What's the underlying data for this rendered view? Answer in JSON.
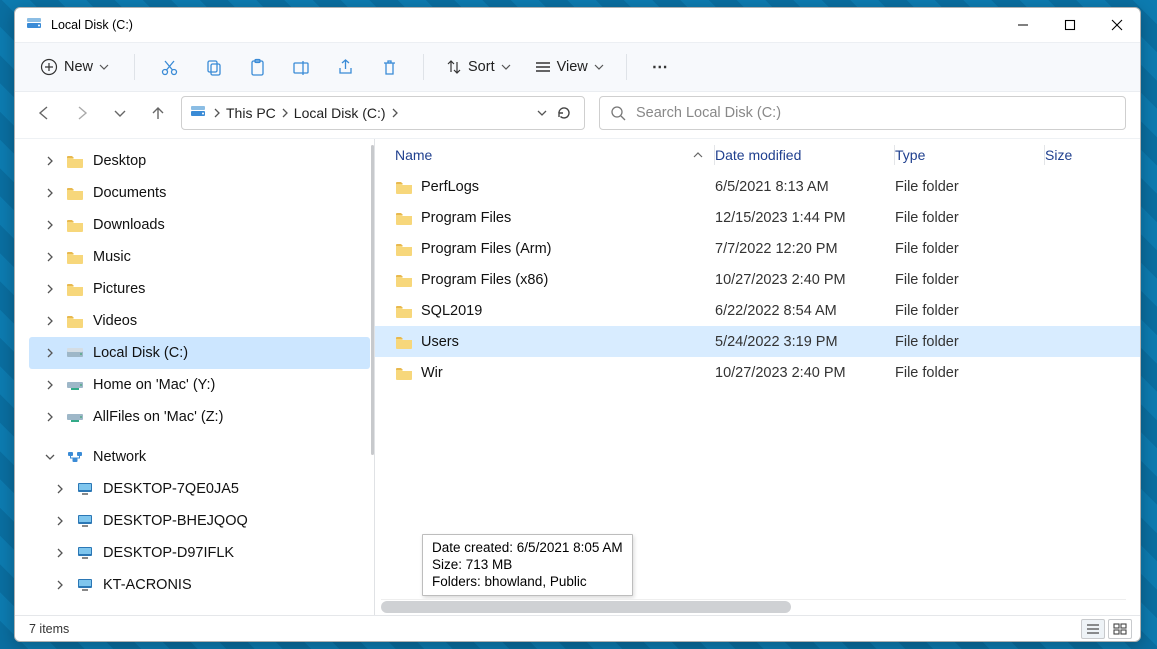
{
  "window": {
    "title": "Local Disk (C:)"
  },
  "toolbar": {
    "new_label": "New",
    "sort_label": "Sort",
    "view_label": "View"
  },
  "breadcrumb": {
    "parts": [
      "This PC",
      "Local Disk (C:)"
    ]
  },
  "search": {
    "placeholder": "Search Local Disk (C:)"
  },
  "sidebar": {
    "items": [
      {
        "label": "Desktop",
        "icon": "folder-icon",
        "exp": "right"
      },
      {
        "label": "Documents",
        "icon": "folder-icon",
        "exp": "right"
      },
      {
        "label": "Downloads",
        "icon": "folder-icon",
        "exp": "right"
      },
      {
        "label": "Music",
        "icon": "folder-icon",
        "exp": "right"
      },
      {
        "label": "Pictures",
        "icon": "folder-icon",
        "exp": "right"
      },
      {
        "label": "Videos",
        "icon": "folder-icon",
        "exp": "right"
      },
      {
        "label": "Local Disk (C:)",
        "icon": "drive-icon",
        "exp": "right",
        "selected": true
      },
      {
        "label": "Home on 'Mac' (Y:)",
        "icon": "netdrive-icon",
        "exp": "right"
      },
      {
        "label": "AllFiles on 'Mac' (Z:)",
        "icon": "netdrive-icon",
        "exp": "right"
      },
      {
        "label": "Network",
        "icon": "network-icon",
        "exp": "down"
      },
      {
        "label": "DESKTOP-7QE0JA5",
        "icon": "pc-icon",
        "exp": "right",
        "child": true
      },
      {
        "label": "DESKTOP-BHEJQOQ",
        "icon": "pc-icon",
        "exp": "right",
        "child": true
      },
      {
        "label": "DESKTOP-D97IFLK",
        "icon": "pc-icon",
        "exp": "right",
        "child": true
      },
      {
        "label": "KT-ACRONIS",
        "icon": "pc-icon",
        "exp": "right",
        "child": true
      }
    ]
  },
  "columns": {
    "name": "Name",
    "date": "Date modified",
    "type": "Type",
    "size": "Size"
  },
  "files": [
    {
      "name": "PerfLogs",
      "date": "6/5/2021 8:13 AM",
      "type": "File folder"
    },
    {
      "name": "Program Files",
      "date": "12/15/2023 1:44 PM",
      "type": "File folder"
    },
    {
      "name": "Program Files (Arm)",
      "date": "7/7/2022 12:20 PM",
      "type": "File folder"
    },
    {
      "name": "Program Files (x86)",
      "date": "10/27/2023 2:40 PM",
      "type": "File folder"
    },
    {
      "name": "SQL2019",
      "date": "6/22/2022 8:54 AM",
      "type": "File folder"
    },
    {
      "name": "Users",
      "date": "5/24/2022 3:19 PM",
      "type": "File folder",
      "selected": true
    },
    {
      "name": "Wir",
      "date": "10/27/2023 2:40 PM",
      "type": "File folder"
    }
  ],
  "tooltip": {
    "line1": "Date created: 6/5/2021 8:05 AM",
    "line2": "Size: 713 MB",
    "line3": "Folders: bhowland, Public"
  },
  "status": {
    "text": "7 items"
  }
}
